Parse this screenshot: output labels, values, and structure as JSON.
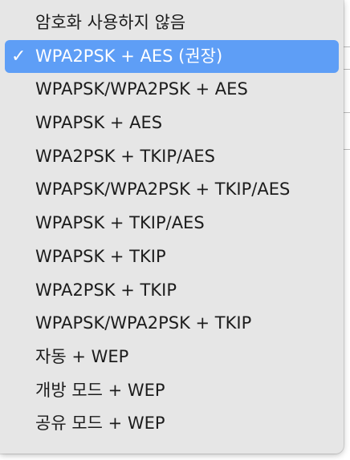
{
  "menu": {
    "check_glyph": "✓",
    "items": [
      {
        "label": "암호화 사용하지 않음"
      },
      {
        "label": "WPA2PSK + AES (권장)"
      },
      {
        "label": "WPAPSK/WPA2PSK + AES"
      },
      {
        "label": "WPAPSK + AES"
      },
      {
        "label": "WPA2PSK + TKIP/AES"
      },
      {
        "label": "WPAPSK/WPA2PSK + TKIP/AES"
      },
      {
        "label": "WPAPSK + TKIP/AES"
      },
      {
        "label": "WPAPSK + TKIP"
      },
      {
        "label": "WPA2PSK + TKIP"
      },
      {
        "label": "WPAPSK/WPA2PSK + TKIP"
      },
      {
        "label": "자동 + WEP"
      },
      {
        "label": "개방 모드 + WEP"
      },
      {
        "label": "공유 모드 + WEP"
      }
    ],
    "selected_index": 1
  },
  "colors": {
    "highlight": "#5e9ef6",
    "menu_background": "#e6e6e6",
    "text": "#1c1c1c"
  }
}
